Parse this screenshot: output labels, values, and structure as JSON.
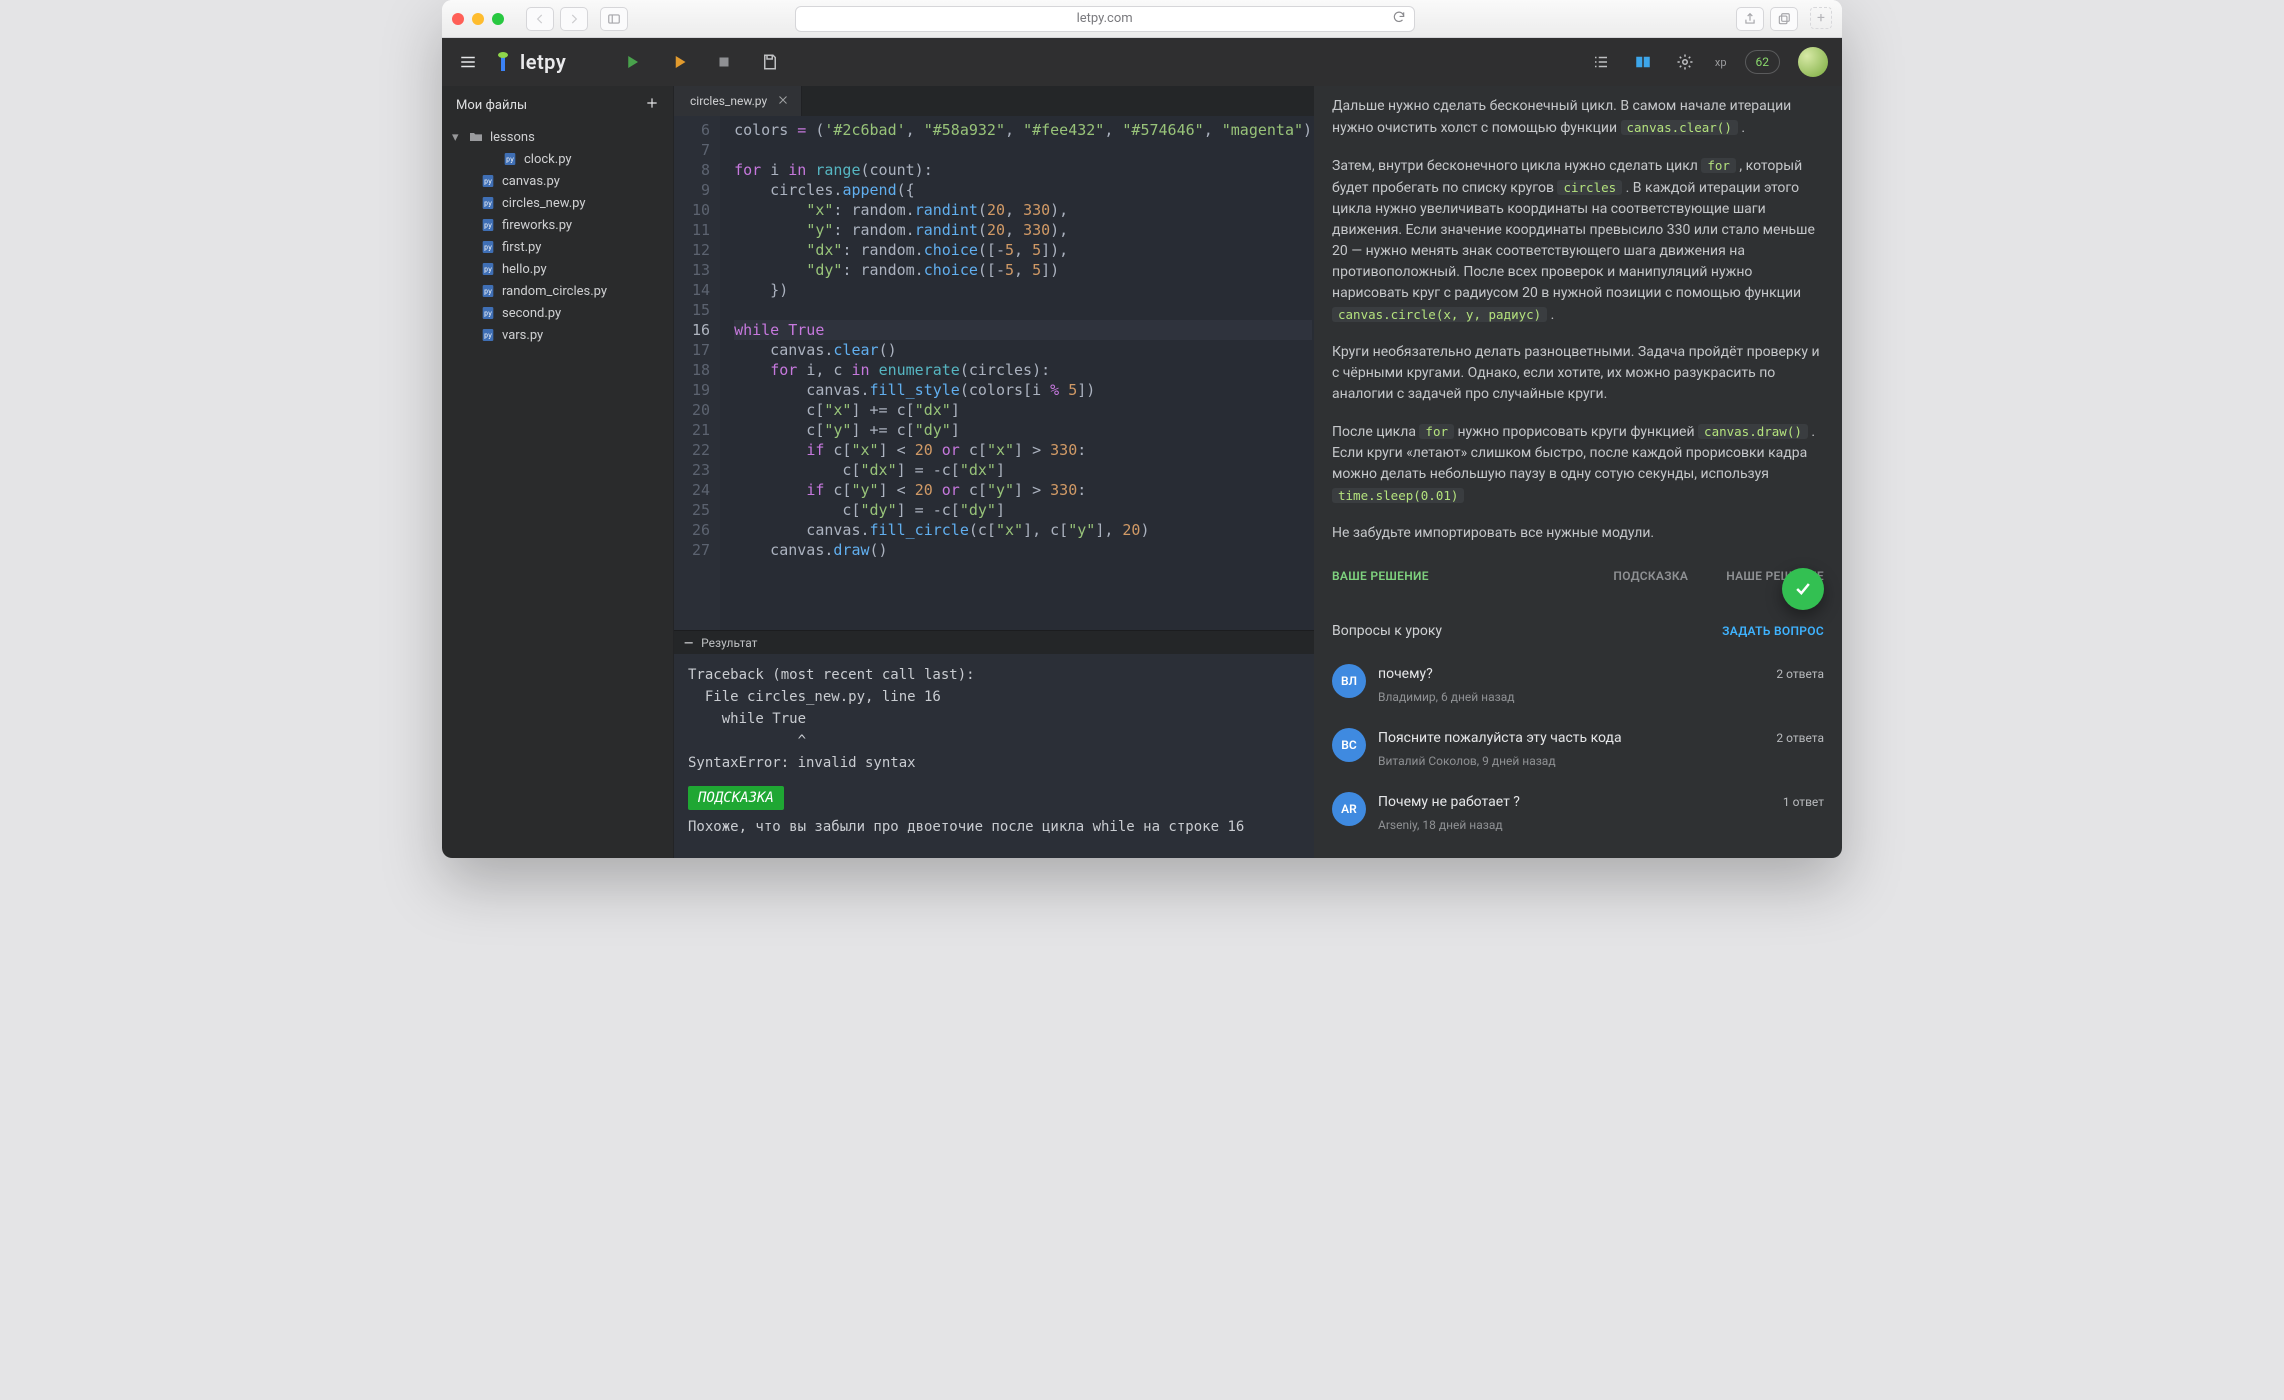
{
  "browser": {
    "address": "letpy.com"
  },
  "app": {
    "brand": "letpy",
    "xp_label": "xp",
    "xp_value": "62"
  },
  "sidebar": {
    "title": "Мои файлы",
    "folder": "lessons",
    "folder_child": "clock.py",
    "files": [
      "canvas.py",
      "circles_new.py",
      "fireworks.py",
      "first.py",
      "hello.py",
      "random_circles.py",
      "second.py",
      "vars.py"
    ]
  },
  "tab": {
    "name": "circles_new.py"
  },
  "editor": {
    "first_line": 6,
    "tokens": [
      [
        [
          "id",
          "colors "
        ],
        [
          "kw",
          "= "
        ],
        [
          "id",
          "("
        ],
        [
          "str",
          "'#2c6bad'"
        ],
        [
          "id",
          ", "
        ],
        [
          "str",
          "\"#58a932\""
        ],
        [
          "id",
          ", "
        ],
        [
          "str",
          "\"#fee432\""
        ],
        [
          "id",
          ", "
        ],
        [
          "str",
          "\"#574646\""
        ],
        [
          "id",
          ", "
        ],
        [
          "str",
          "\"magenta\""
        ],
        [
          "id",
          ")"
        ]
      ],
      [],
      [
        [
          "kw",
          "for "
        ],
        [
          "id",
          "i "
        ],
        [
          "kw",
          "in "
        ],
        [
          "builtin",
          "range"
        ],
        [
          "id",
          "(count):"
        ]
      ],
      [
        [
          "id",
          "    circles."
        ],
        [
          "func",
          "append"
        ],
        [
          "id",
          "({"
        ]
      ],
      [
        [
          "id",
          "        "
        ],
        [
          "str",
          "\"x\""
        ],
        [
          "id",
          ": random."
        ],
        [
          "func",
          "randint"
        ],
        [
          "id",
          "("
        ],
        [
          "num",
          "20"
        ],
        [
          "id",
          ", "
        ],
        [
          "num",
          "330"
        ],
        [
          "id",
          "),"
        ]
      ],
      [
        [
          "id",
          "        "
        ],
        [
          "str",
          "\"y\""
        ],
        [
          "id",
          ": random."
        ],
        [
          "func",
          "randint"
        ],
        [
          "id",
          "("
        ],
        [
          "num",
          "20"
        ],
        [
          "id",
          ", "
        ],
        [
          "num",
          "330"
        ],
        [
          "id",
          "),"
        ]
      ],
      [
        [
          "id",
          "        "
        ],
        [
          "str",
          "\"dx\""
        ],
        [
          "id",
          ": random."
        ],
        [
          "func",
          "choice"
        ],
        [
          "id",
          "([-"
        ],
        [
          "num",
          "5"
        ],
        [
          "id",
          ", "
        ],
        [
          "num",
          "5"
        ],
        [
          "id",
          "]),"
        ]
      ],
      [
        [
          "id",
          "        "
        ],
        [
          "str",
          "\"dy\""
        ],
        [
          "id",
          ": random."
        ],
        [
          "func",
          "choice"
        ],
        [
          "id",
          "([-"
        ],
        [
          "num",
          "5"
        ],
        [
          "id",
          ", "
        ],
        [
          "num",
          "5"
        ],
        [
          "id",
          "])"
        ]
      ],
      [
        [
          "id",
          "    })"
        ]
      ],
      [],
      [
        [
          "kw",
          "while "
        ],
        [
          "kw",
          "True"
        ]
      ],
      [
        [
          "id",
          "    canvas."
        ],
        [
          "func",
          "clear"
        ],
        [
          "id",
          "()"
        ]
      ],
      [
        [
          "id",
          "    "
        ],
        [
          "kw",
          "for "
        ],
        [
          "id",
          "i, c "
        ],
        [
          "kw",
          "in "
        ],
        [
          "builtin",
          "enumerate"
        ],
        [
          "id",
          "(circles):"
        ]
      ],
      [
        [
          "id",
          "        canvas."
        ],
        [
          "func",
          "fill_style"
        ],
        [
          "id",
          "(colors[i "
        ],
        [
          "kw",
          "%"
        ],
        [
          "id",
          " "
        ],
        [
          "num",
          "5"
        ],
        [
          "id",
          "])"
        ]
      ],
      [
        [
          "id",
          "        c["
        ],
        [
          "str",
          "\"x\""
        ],
        [
          "id",
          "] += c["
        ],
        [
          "str",
          "\"dx\""
        ],
        [
          "id",
          "]"
        ]
      ],
      [
        [
          "id",
          "        c["
        ],
        [
          "str",
          "\"y\""
        ],
        [
          "id",
          "] += c["
        ],
        [
          "str",
          "\"dy\""
        ],
        [
          "id",
          "]"
        ]
      ],
      [
        [
          "id",
          "        "
        ],
        [
          "kw",
          "if"
        ],
        [
          "id",
          " c["
        ],
        [
          "str",
          "\"x\""
        ],
        [
          "id",
          "] < "
        ],
        [
          "num",
          "20"
        ],
        [
          "id",
          " "
        ],
        [
          "kw",
          "or"
        ],
        [
          "id",
          " c["
        ],
        [
          "str",
          "\"x\""
        ],
        [
          "id",
          "] > "
        ],
        [
          "num",
          "330"
        ],
        [
          "id",
          ":"
        ]
      ],
      [
        [
          "id",
          "            c["
        ],
        [
          "str",
          "\"dx\""
        ],
        [
          "id",
          "] = -c["
        ],
        [
          "str",
          "\"dx\""
        ],
        [
          "id",
          "]"
        ]
      ],
      [
        [
          "id",
          "        "
        ],
        [
          "kw",
          "if"
        ],
        [
          "id",
          " c["
        ],
        [
          "str",
          "\"y\""
        ],
        [
          "id",
          "] < "
        ],
        [
          "num",
          "20"
        ],
        [
          "id",
          " "
        ],
        [
          "kw",
          "or"
        ],
        [
          "id",
          " c["
        ],
        [
          "str",
          "\"y\""
        ],
        [
          "id",
          "] > "
        ],
        [
          "num",
          "330"
        ],
        [
          "id",
          ":"
        ]
      ],
      [
        [
          "id",
          "            c["
        ],
        [
          "str",
          "\"dy\""
        ],
        [
          "id",
          "] = -c["
        ],
        [
          "str",
          "\"dy\""
        ],
        [
          "id",
          "]"
        ]
      ],
      [
        [
          "id",
          "        canvas."
        ],
        [
          "func",
          "fill_circle"
        ],
        [
          "id",
          "(c["
        ],
        [
          "str",
          "\"x\""
        ],
        [
          "id",
          "], c["
        ],
        [
          "str",
          "\"y\""
        ],
        [
          "id",
          "], "
        ],
        [
          "num",
          "20"
        ],
        [
          "id",
          ")"
        ]
      ],
      [
        [
          "id",
          "    canvas."
        ],
        [
          "func",
          "draw"
        ],
        [
          "id",
          "()"
        ]
      ]
    ],
    "highlight_index": 10
  },
  "result": {
    "header": "Результат",
    "traceback": "Traceback (most recent call last):\n  File circles_new.py, line 16\n    while True\n             ^\nSyntaxError: invalid syntax",
    "hint_label": "ПОДСКАЗКА",
    "hint_text": "Похоже, что вы забыли про двоеточие после цикла while на строке 16"
  },
  "lesson": {
    "p1a": "Дальше нужно сделать бесконечный цикл. В самом начале итерации нужно очистить холст с помощью функции ",
    "code1": "canvas.clear()",
    "p1b": " .",
    "p2a": "Затем, внутри бесконечного цикла нужно сделать цикл ",
    "code2": "for",
    "p2b": " , который будет пробегать по списку кругов ",
    "code3": "circles",
    "p2c": " . В каждой итерации этого цикла нужно увеличивать координаты на соответствующие шаги движения. Если значение координаты превысило 330 или стало меньше 20 — нужно менять знак соответствующего шага движения на противоположный. После всех проверок и манипуляций нужно нарисовать круг с радиусом 20 в нужной позиции с помощью функции ",
    "code4": "canvas.circle(x, y, радиус)",
    "p2d": " .",
    "p3": "Круги необязательно делать разноцветными. Задача пройдёт проверку и с чёрными кругами. Однако, если хотите, их можно разукрасить по аналогии с задачей про случайные круги.",
    "p4a": "После цикла ",
    "code5": "for",
    "p4b": " нужно прорисовать круги функцией ",
    "code6": "canvas.draw()",
    "p4c": " . Если круги «летают» слишком быстро, после каждой прорисовки кадра можно делать небольшую паузу в одну сотую секунды, используя ",
    "code7": "time.sleep(0.01)",
    "p5": "Не забудьте импортировать все нужные модули.",
    "tabs": {
      "your": "ВАШЕ РЕШЕНИЕ",
      "hint": "ПОДСКАЗКА",
      "our": "НАШЕ РЕШЕНИЕ"
    }
  },
  "qa": {
    "title": "Вопросы к уроку",
    "ask": "ЗАДАТЬ ВОПРОС",
    "items": [
      {
        "initials": "ВЛ",
        "color": "#3f8ae0",
        "title": "почему?",
        "meta": "Владимир, 6 дней назад",
        "answers": "2 ответа"
      },
      {
        "initials": "ВС",
        "color": "#3f8ae0",
        "title": "Поясните пожалуйста эту часть кода",
        "meta": "Виталий Соколов, 9 дней назад",
        "answers": "2 ответа"
      },
      {
        "initials": "AR",
        "color": "#3f8ae0",
        "title": "Почему не работает ?",
        "meta": "Arseniy, 18 дней назад",
        "answers": "1 ответ"
      }
    ]
  }
}
